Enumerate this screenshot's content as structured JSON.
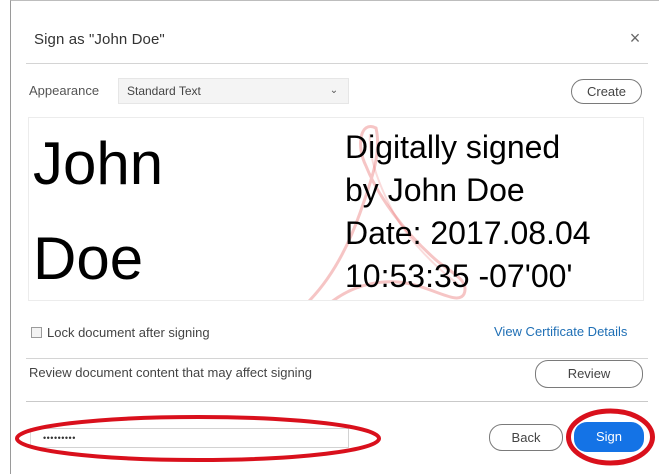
{
  "dialog": {
    "title": "Sign as \"John Doe\"",
    "close_label": "×"
  },
  "appearance": {
    "label": "Appearance",
    "selected": "Standard Text",
    "create_label": "Create"
  },
  "preview": {
    "name_first": "John",
    "name_last": "Doe",
    "detail_lines": [
      "Digitally signed",
      "by John Doe",
      "Date: 2017.08.04",
      "10:53:35 -07'00'"
    ]
  },
  "options": {
    "lock_label": "Lock document after signing",
    "lock_checked": false,
    "view_certificate_label": "View Certificate Details"
  },
  "review": {
    "text": "Review document content that may affect signing",
    "button_label": "Review"
  },
  "footer": {
    "password_value": "•••••••••",
    "back_label": "Back",
    "sign_label": "Sign"
  },
  "colors": {
    "sign_button": "#1473e6",
    "link": "#1f6fb5",
    "annotation_red": "#d9101c"
  },
  "icons": {
    "close": "close-icon",
    "dropdown": "chevron-down-icon",
    "watermark": "acrobat-logo-icon"
  }
}
